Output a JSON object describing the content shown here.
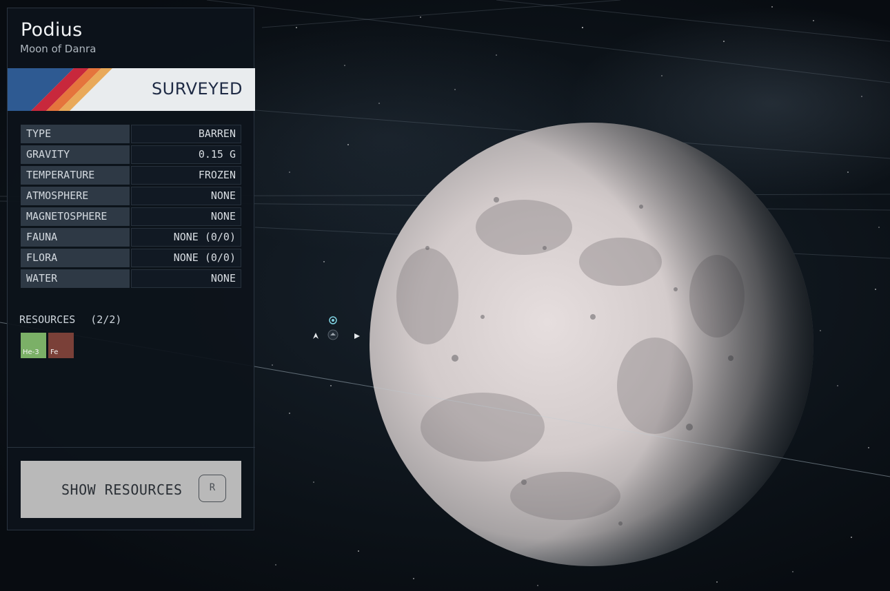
{
  "body": {
    "name": "Podius",
    "subtitle": "Moon of Danra",
    "status": "SURVEYED"
  },
  "stats": [
    {
      "key": "TYPE",
      "value": "BARREN"
    },
    {
      "key": "GRAVITY",
      "value": "0.15 G"
    },
    {
      "key": "TEMPERATURE",
      "value": "FROZEN"
    },
    {
      "key": "ATMOSPHERE",
      "value": "NONE"
    },
    {
      "key": "MAGNETOSPHERE",
      "value": "NONE"
    },
    {
      "key": "FAUNA",
      "value": "NONE (0/0)"
    },
    {
      "key": "FLORA",
      "value": "NONE (0/0)"
    },
    {
      "key": "WATER",
      "value": "NONE"
    }
  ],
  "resources": {
    "label": "RESOURCES",
    "count": "(2/2)",
    "items": [
      {
        "symbol": "He-3",
        "color": "#7bb067"
      },
      {
        "symbol": "Fe",
        "color": "#7a4038"
      }
    ]
  },
  "actions": {
    "show_resources_label": "SHOW RESOURCES",
    "show_resources_key": "R"
  },
  "colors": {
    "banner_blue": "#2e5a92",
    "banner_red": "#c8283c",
    "banner_orange": "#e5743c",
    "banner_yellow": "#e9a95a",
    "accent_text": "#1e2a44"
  }
}
